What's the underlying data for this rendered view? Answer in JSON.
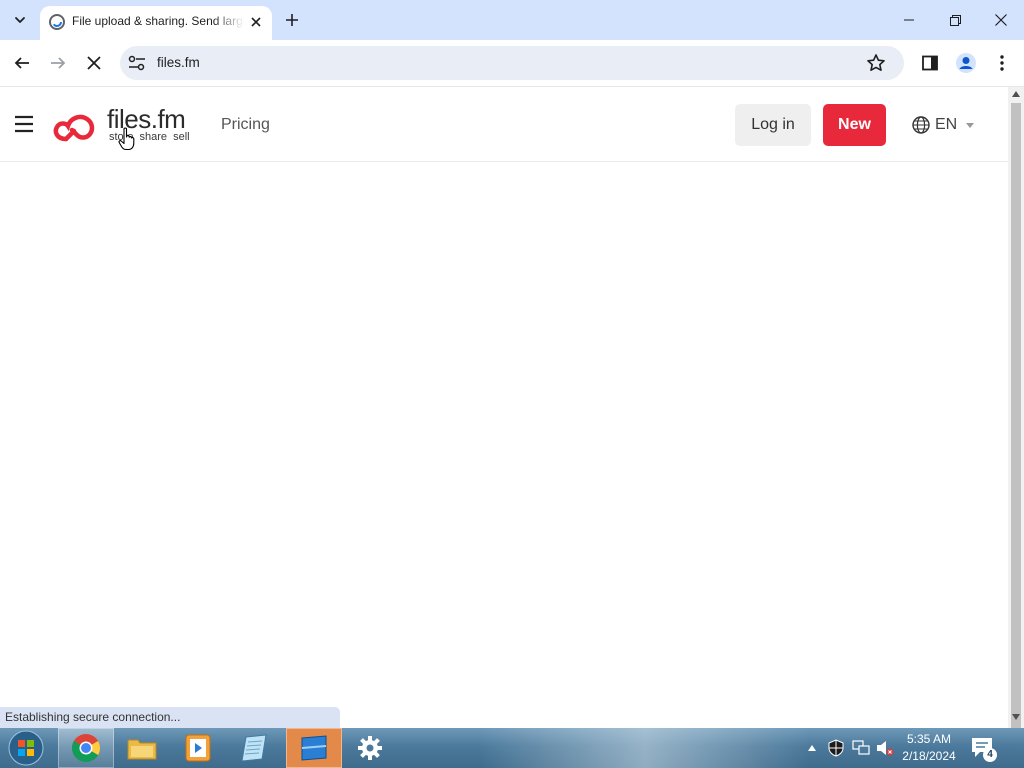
{
  "browser": {
    "tab_title": "File upload & sharing. Send large files",
    "url": "files.fm",
    "status_text": "Establishing secure connection..."
  },
  "site": {
    "logo_word": "files.fm",
    "logo_tagline": "store share sell",
    "nav_pricing": "Pricing",
    "login_label": "Log in",
    "new_label": "New",
    "language": "EN",
    "accent_color": "#e8293c"
  },
  "taskbar": {
    "time": "5:35 AM",
    "date": "2/18/2024",
    "notification_count": "4"
  },
  "icons": [
    "tab-search-icon",
    "favicon-icon",
    "close-icon",
    "plus-icon",
    "minimize-icon",
    "restore-icon",
    "back-arrow-icon",
    "forward-arrow-icon",
    "stop-loading-icon",
    "site-info-icon",
    "star-icon",
    "side-panel-icon",
    "profile-icon",
    "more-icon",
    "hamburger-icon",
    "globe-icon",
    "caret-down-icon",
    "windows-start-icon",
    "chrome-icon",
    "folder-icon",
    "media-player-icon",
    "notepad-icon",
    "app-icon",
    "settings-gear-icon"
  ]
}
